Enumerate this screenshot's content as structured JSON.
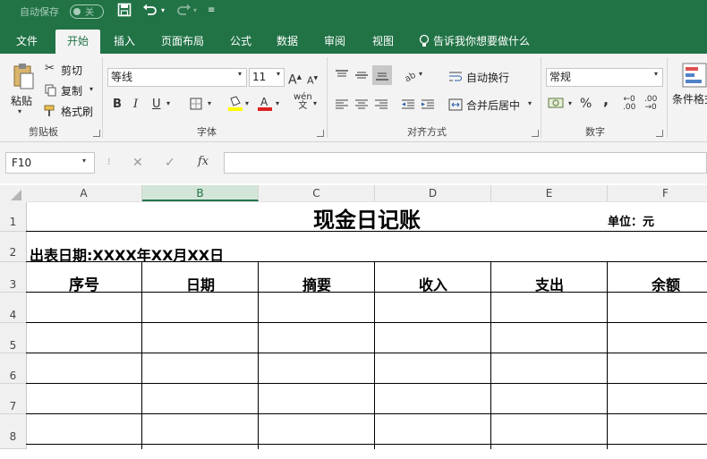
{
  "titlebar": {
    "autosave_label": "自动保存",
    "autosave_state": "关",
    "save_icon": "save-icon",
    "undo_icon": "undo-icon",
    "redo_icon": "redo-icon",
    "customize_icon": "customize-icon"
  },
  "tabs": [
    {
      "label": "文件"
    },
    {
      "label": "开始"
    },
    {
      "label": "插入"
    },
    {
      "label": "页面布局"
    },
    {
      "label": "公式"
    },
    {
      "label": "数据"
    },
    {
      "label": "审阅"
    },
    {
      "label": "视图"
    }
  ],
  "tell_me": "告诉我你想要做什么",
  "ribbon": {
    "clipboard": {
      "paste": "粘贴",
      "cut": "剪切",
      "copy": "复制",
      "format_painter": "格式刷",
      "group": "剪贴板"
    },
    "font": {
      "name": "等线",
      "size": "11",
      "bold": "B",
      "italic": "I",
      "underline": "U",
      "group": "字体"
    },
    "alignment": {
      "wrap_text": "自动换行",
      "merge_center": "合并后居中",
      "group": "对齐方式"
    },
    "number": {
      "format": "常规",
      "percent": "%",
      "comma": ",",
      "group": "数字"
    },
    "styles": {
      "conditional": "条件格式"
    }
  },
  "formula_bar": {
    "name_box": "F10",
    "fx": "fx",
    "value": ""
  },
  "columns": [
    "A",
    "B",
    "C",
    "D",
    "E",
    "F"
  ],
  "selected_column": "B",
  "rows": [
    "1",
    "2",
    "3",
    "4",
    "5",
    "6",
    "7",
    "8"
  ],
  "sheet": {
    "title": "现金日记账",
    "unit": "单位：元",
    "date_line": "出表日期:XXXX年XX月XX日",
    "headers": [
      "序号",
      "日期",
      "摘要",
      "收入",
      "支出",
      "余额"
    ]
  },
  "colors": {
    "accent": "#217346",
    "ribbon_bg": "#f3f3f3"
  }
}
